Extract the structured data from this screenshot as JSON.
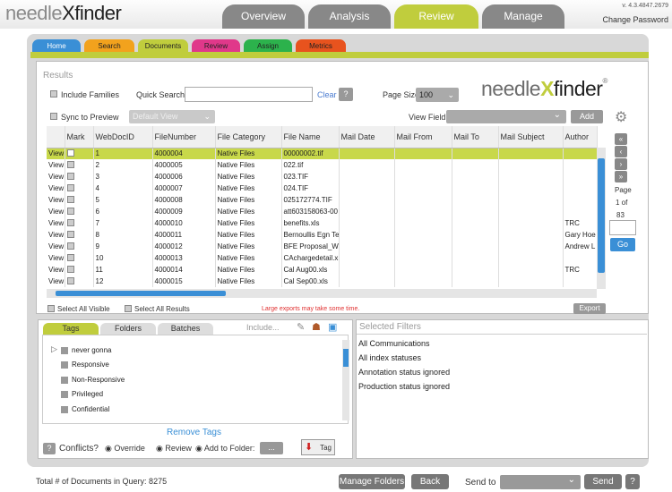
{
  "app": {
    "version": "v. 4.3.4847.2679",
    "change_password": "Change Password",
    "logo_left": "needle",
    "logo_right": "finder"
  },
  "main_tabs": [
    "Overview",
    "Analysis",
    "Review",
    "Manage"
  ],
  "sub_tabs": [
    "Home",
    "Search",
    "Documents",
    "Review",
    "Assign",
    "Metrics"
  ],
  "sub_tab_colors": [
    "#3a8fd6",
    "#f2a21d",
    "#c0cd3d",
    "#e0388a",
    "#2cb24c",
    "#e8531e"
  ],
  "results": {
    "title": "Results",
    "include_families": "Include Families",
    "quick_search_label": "Quick Search",
    "clear": "Clear",
    "help": "?",
    "page_size_label": "Page Size",
    "page_size": "100",
    "sync_preview": "Sync to Preview",
    "default_view": "Default View",
    "view_field_label": "View Field",
    "add": "Add"
  },
  "grid": {
    "headers": [
      "Mark",
      "WebDocID",
      "FileNumber",
      "File Category",
      "File Name",
      "Mail Date",
      "Mail From",
      "Mail To",
      "Mail Subject",
      "Author"
    ],
    "view_label": "View",
    "rows": [
      [
        "1",
        "4000004",
        "Native Files",
        "00000002.tif",
        ""
      ],
      [
        "2",
        "4000005",
        "Native Files",
        "022.tif",
        ""
      ],
      [
        "3",
        "4000006",
        "Native Files",
        "023.TIF",
        ""
      ],
      [
        "4",
        "4000007",
        "Native Files",
        "024.TIF",
        ""
      ],
      [
        "5",
        "4000008",
        "Native Files",
        "025172774.TIF",
        ""
      ],
      [
        "6",
        "4000009",
        "Native Files",
        "att603158063-00",
        ""
      ],
      [
        "7",
        "4000010",
        "Native Files",
        "benefits.xls",
        "TRC"
      ],
      [
        "8",
        "4000011",
        "Native Files",
        "Bernoullis Egn Te",
        "Gary Hoe"
      ],
      [
        "9",
        "4000012",
        "Native Files",
        "BFE Proposal_W",
        "Andrew L"
      ],
      [
        "10",
        "4000013",
        "Native Files",
        "CAchargedetail.x",
        ""
      ],
      [
        "11",
        "4000014",
        "Native Files",
        "Cal Aug00.xls",
        "TRC"
      ],
      [
        "12",
        "4000015",
        "Native Files",
        "Cal Sep00.xls",
        ""
      ]
    ]
  },
  "pager": {
    "page": "Page",
    "of": "1 of",
    "total": "83",
    "go": "Go"
  },
  "footer_bar": {
    "select_visible": "Select All Visible",
    "select_results": "Select All Results",
    "warning": "Large exports may take some time.",
    "export": "Export"
  },
  "tags_panel": {
    "tabs": [
      "Tags",
      "Folders",
      "Batches"
    ],
    "include": "Include...",
    "items": [
      "never gonna",
      "Responsive",
      "Non-Responsive",
      "Privileged",
      "Confidential"
    ],
    "remove_tags": "Remove Tags",
    "conflicts": "Conflicts?",
    "override": "Override",
    "review": "Review",
    "add_to_folder": "Add to Folder:",
    "dots": "...",
    "tag_btn": "Tag"
  },
  "filters": {
    "title": "Selected Filters",
    "items": [
      "All Communications",
      "All index statuses",
      "Annotation status ignored",
      "Production status ignored"
    ]
  },
  "bottom": {
    "total": "Total # of Documents in Query: 8275",
    "manage_folders": "Manage Folders",
    "back": "Back",
    "send_to": "Send to",
    "send": "Send",
    "help": "?"
  },
  "colors": {
    "accent": "#c0cd3d",
    "link": "#4a7bd0",
    "warning": "#e03030"
  }
}
